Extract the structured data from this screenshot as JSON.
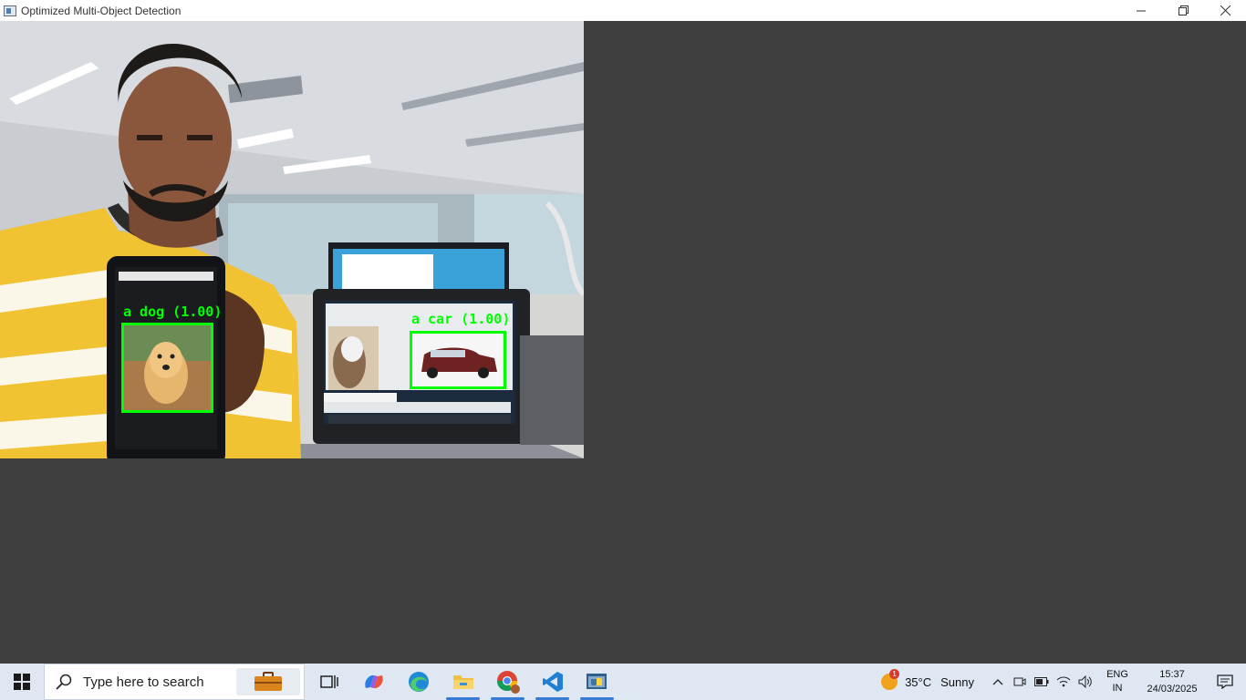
{
  "window": {
    "title": "Optimized Multi-Object Detection"
  },
  "detections": [
    {
      "label": "a dog (1.00)",
      "object": "dog"
    },
    {
      "label": "a car (1.00)",
      "object": "car"
    }
  ],
  "taskbar": {
    "search_placeholder": "Type here to search",
    "apps": [
      "task-view",
      "copilot",
      "edge",
      "file-explorer",
      "chrome",
      "vscode",
      "python"
    ],
    "weather": {
      "temp": "35°C",
      "condition": "Sunny",
      "badge": "1"
    },
    "language": {
      "line1": "ENG",
      "line2": "IN"
    },
    "clock": {
      "time": "15:37",
      "date": "24/03/2025"
    }
  },
  "colors": {
    "detection_box": "#00ff00",
    "window_bg": "#3f3f3f",
    "taskbar_bg": "#dfe7f2"
  }
}
